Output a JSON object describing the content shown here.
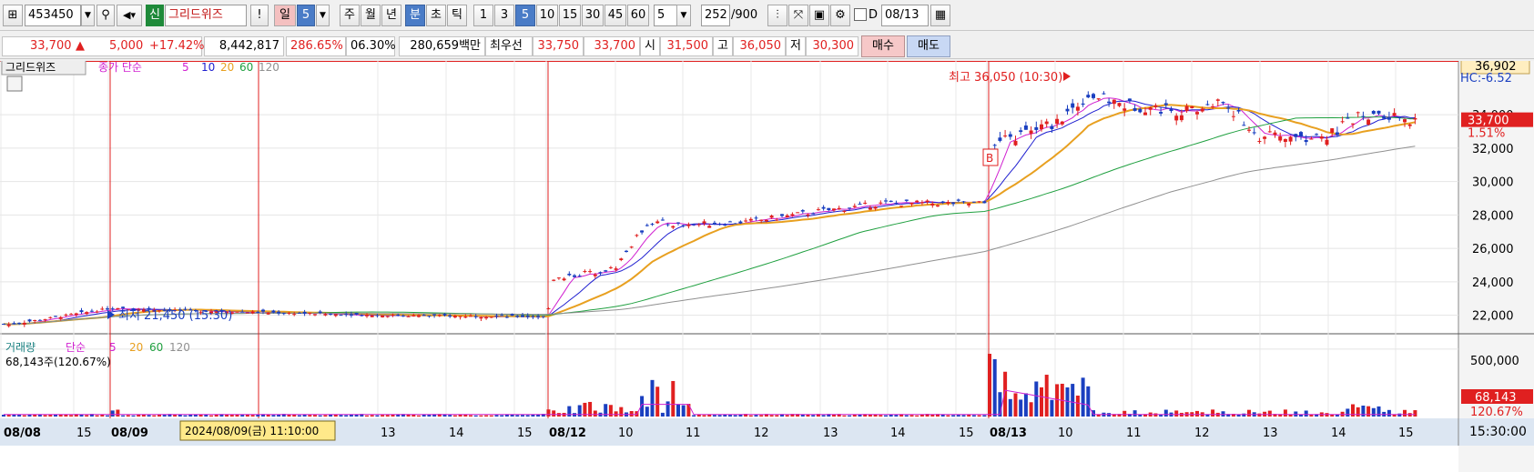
{
  "toolbar": {
    "code": "453450",
    "market_badge": "신",
    "stock_name": "그리드위즈",
    "period_buttons": [
      "일",
      "5",
      "주",
      "월",
      "년",
      "분",
      "초",
      "틱"
    ],
    "minute_buttons": [
      "1",
      "3",
      "5",
      "10",
      "15",
      "30",
      "45",
      "60"
    ],
    "custom_period": "5",
    "count_value": "252",
    "count_total": "/900",
    "date_prefix": "D",
    "date_value": "08/13"
  },
  "quote": {
    "price": "33,700",
    "direction": "▲",
    "change": "5,000",
    "change_pct": "+17.42%",
    "volume": "8,442,817",
    "volume_ratio": "286.65%",
    "turnover": "06.30%",
    "amount": "280,659백만",
    "best_label": "최우선",
    "best_ask": "33,750",
    "best_bid": "33,700",
    "open_label": "시",
    "open": "31,500",
    "high_label": "고",
    "high": "36,050",
    "low_label": "저",
    "low": "30,300",
    "buy_label": "매수",
    "sell_label": "매도"
  },
  "price_panel": {
    "name_tag": "그리드위즈",
    "ma_legend_prefix": "종가 단순",
    "ma_periods": [
      "5",
      "10",
      "20",
      "60",
      "120"
    ],
    "ma_colors": [
      "#d020d0",
      "#2020d0",
      "#e8a020",
      "#20a040",
      "#909090"
    ],
    "max_annotation": "최고 36,050 (10:30)",
    "min_annotation": "최저 21,450 (15:30)",
    "marker_b": "B",
    "top_box_value": "36,902",
    "indicator_text": "HC:-6.52",
    "current_price_tag": "33,700",
    "current_pct_tag": "1.51%",
    "y_ticks": [
      "34,000",
      "32,000",
      "30,000",
      "28,000",
      "26,000",
      "24,000",
      "22,000"
    ]
  },
  "volume_panel": {
    "title": "거래량",
    "ma_legend_prefix": "단순",
    "ma_periods": [
      "5",
      "20",
      "60",
      "120"
    ],
    "current_volume": "68,143주(120.67%)",
    "y_tick": "500,000",
    "current_volume_tag": "68,143",
    "current_volume_pct_tag": "120.67%"
  },
  "x_axis": {
    "labels": [
      "08/08",
      "15",
      "08/09",
      "13",
      "14",
      "15",
      "08/12",
      "10",
      "11",
      "12",
      "13",
      "14",
      "15",
      "08/13",
      "10",
      "11",
      "12",
      "13",
      "14",
      "15"
    ],
    "crosshair_label": "2024/08/09(금) 11:10:00",
    "time_label": "15:30:00"
  },
  "chart_data": {
    "type": "line",
    "title": "",
    "series": [
      {
        "name": "종가",
        "x": [
          "08/08 14:00",
          "08/08 15:30",
          "08/09 09:00",
          "08/09 11:00",
          "08/09 13:00",
          "08/09 15:30",
          "08/12 09:05",
          "08/12 10:00",
          "08/12 10:30",
          "08/12 11:00",
          "08/12 12:00",
          "08/12 13:00",
          "08/12 14:00",
          "08/12 15:30",
          "08/13 09:00",
          "08/13 09:30",
          "08/13 10:00",
          "08/13 10:30",
          "08/13 11:00",
          "08/13 12:00",
          "08/13 12:30",
          "08/13 13:00",
          "08/13 14:00",
          "08/13 14:30",
          "08/13 15:30"
        ],
        "values": [
          21800,
          21450,
          22400,
          22200,
          22000,
          21900,
          24200,
          24800,
          27600,
          27400,
          27600,
          28200,
          28700,
          28700,
          32000,
          32800,
          33500,
          35200,
          34600,
          34200,
          34800,
          32700,
          32600,
          33900,
          33700
        ]
      }
    ],
    "ylim": [
      21000,
      37000
    ],
    "volume_ylim": [
      0,
      600000
    ]
  }
}
